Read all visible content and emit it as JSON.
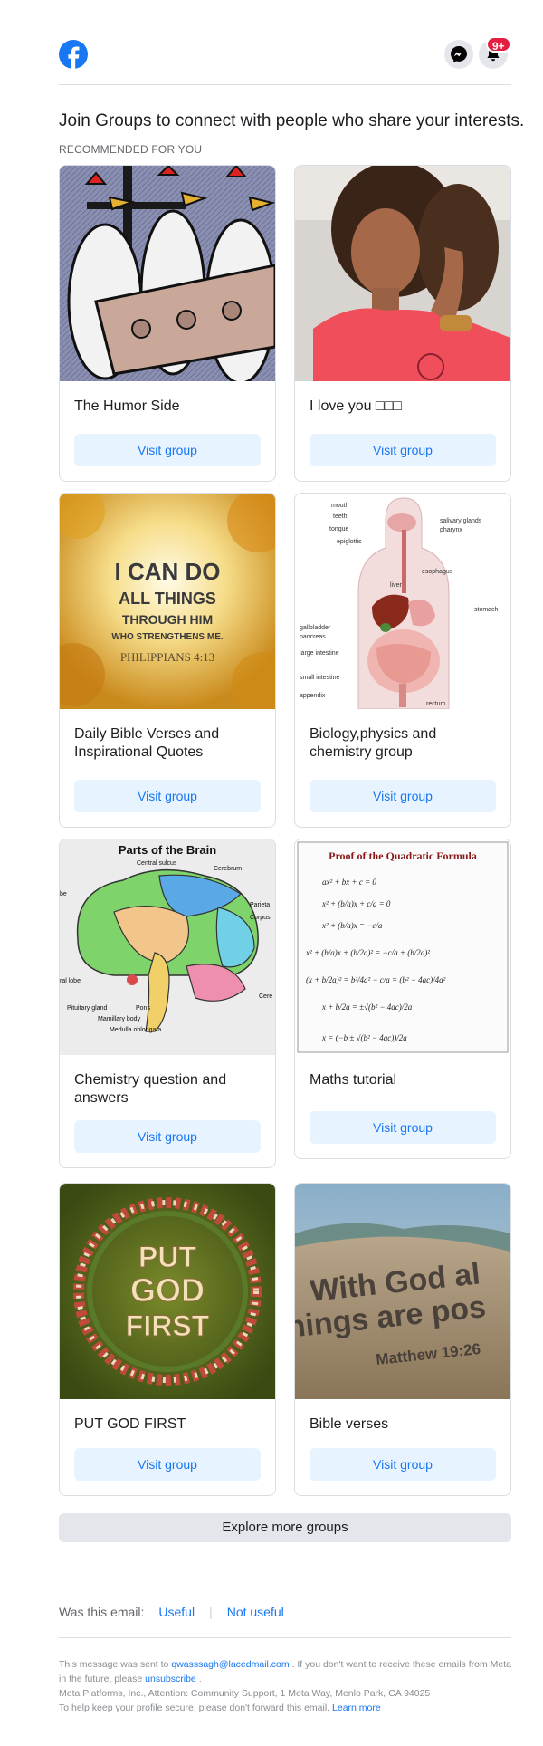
{
  "header": {
    "logo_icon": "facebook-logo-icon",
    "messenger_icon": "messenger-icon",
    "notifications_icon": "bell-icon",
    "notification_count": "9+",
    "brand_color": "#1877f2",
    "badge_color": "#e41e3f"
  },
  "intro": {
    "text": "Join Groups to connect with people who share your interests.",
    "recommended_label": "RECOMMENDED FOR YOU"
  },
  "groups": [
    {
      "name": "The Humor Side",
      "button": "Visit group"
    },
    {
      "name": "I love you □□□",
      "button": "Visit group"
    },
    {
      "name": "Daily Bible Verses and Inspirational Quotes",
      "button": "Visit group"
    },
    {
      "name": "Biology,physics and chemistry group",
      "button": "Visit group"
    },
    {
      "name": "Chemistry question and answers",
      "button": "Visit group"
    },
    {
      "name": "Maths tutorial",
      "button": "Visit group"
    },
    {
      "name": "PUT GOD FIRST",
      "button": "Visit group"
    },
    {
      "name": "Bible verses",
      "button": "Visit group"
    }
  ],
  "images": {
    "bible_quote": {
      "line1": "I CAN DO",
      "line2": "ALL THINGS",
      "line3": "THROUGH HIM",
      "line4": "WHO STRENGTHENS ME.",
      "ref": "PHILIPPIANS 4:13"
    },
    "anatomy": {
      "labels": [
        "mouth",
        "teeth",
        "tongue",
        "epiglottis",
        "salivary glands",
        "pharynx",
        "esophagus",
        "liver",
        "stomach",
        "gallbladder",
        "pancreas",
        "large intestine",
        "small intestine",
        "appendix",
        "rectum"
      ]
    },
    "brain": {
      "title": "Parts of the Brain",
      "labels": [
        "Central sulcus",
        "Cerebrum",
        "Parieta",
        "Corpus",
        "Pituitary gland",
        "Pons",
        "Mamillary body",
        "Medulla oblongata",
        "Cere",
        "be",
        "ral lobe"
      ]
    },
    "quadratic": {
      "title": "Proof of the Quadratic Formula",
      "lines": [
        "ax² + bx + c = 0",
        "x² + (b/a)x + c/a = 0",
        "x² + (b/a)x = −c/a",
        "x² + (b/a)x + (b/2a)² = −c/a + (b/2a)²",
        "(x + b/2a)² = b²/4a² − c/a = (b² − 4ac)/4a²",
        "x + b/2a = ±√(b² − 4ac)/2a",
        "x = (−b ± √(b² − 4ac))/2a"
      ]
    },
    "god_first": {
      "line1": "PUT",
      "line2": "GOD",
      "line3": "FIRST"
    },
    "sand": {
      "line1": "With God al",
      "line2": "hings are pos",
      "line3": "Matthew 19:26"
    }
  },
  "explore_button": "Explore more groups",
  "feedback": {
    "question": "Was this email:",
    "useful": "Useful",
    "not_useful": "Not useful"
  },
  "footer": {
    "sent_prefix": "This message was sent to",
    "email": "qwasssagh@lacedmail.com",
    "sent_suffix": ". If you don't want to receive these emails from Meta in the future, please",
    "unsubscribe": "unsubscribe",
    "period": ".",
    "address": "Meta Platforms, Inc., Attention: Community Support, 1 Meta Way, Menlo Park, CA 94025",
    "security_text": "To help keep your profile secure, please don't forward this email.",
    "learn_more": "Learn more"
  }
}
